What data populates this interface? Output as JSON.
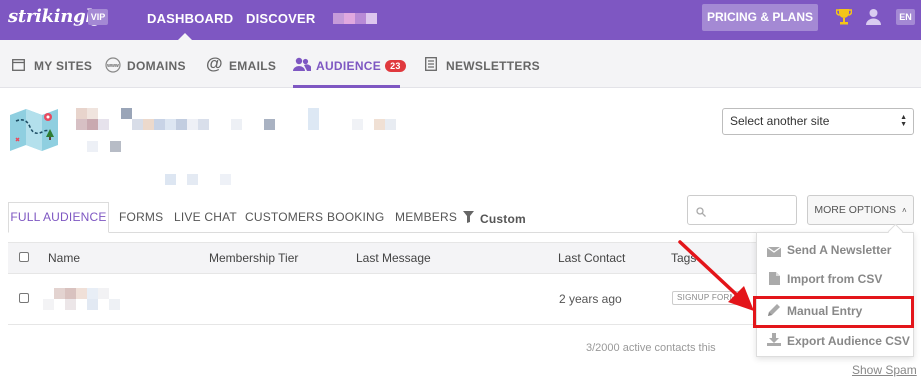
{
  "topbar": {
    "logo": "strikingly",
    "vip": "VIP",
    "nav": [
      "DASHBOARD",
      "DISCOVER"
    ],
    "pricing_label": "PRICING & PLANS",
    "lang": "EN",
    "icons": [
      "trophy-icon",
      "user-icon"
    ],
    "colors": {
      "bar": "#7e57c2",
      "button": "#a489d4"
    }
  },
  "subnav": {
    "tabs": [
      {
        "label": "MY SITES",
        "icon": "window-icon"
      },
      {
        "label": "DOMAINS",
        "icon": "www-icon"
      },
      {
        "label": "EMAILS",
        "icon": "at-icon"
      },
      {
        "label": "AUDIENCE",
        "icon": "users-icon",
        "badge": "23",
        "active": true
      },
      {
        "label": "NEWSLETTERS",
        "icon": "newsletter-icon"
      }
    ],
    "colors": {
      "active": "#7e57c2",
      "badge": "#e0393e"
    }
  },
  "site": {
    "select_placeholder": "Select another site",
    "illustration": "map-icon"
  },
  "audience": {
    "tabs": [
      "FULL AUDIENCE",
      "FORMS",
      "LIVE CHAT",
      "CUSTOMERS",
      "BOOKING",
      "MEMBERS",
      "Custom"
    ],
    "more_options": "MORE OPTIONS",
    "columns": [
      "Name",
      "Membership Tier",
      "Last Message",
      "Last Contact",
      "Tags"
    ],
    "rows": [
      {
        "last_contact": "2 years ago",
        "tag": "SIGNUP FORM"
      }
    ],
    "count_text": "3/2000 active contacts this",
    "show_spam": "Show Spam"
  },
  "dropdown": {
    "items": [
      {
        "label": "Send A Newsletter",
        "icon": "envelope-icon"
      },
      {
        "label": "Import from CSV",
        "icon": "file-icon"
      },
      {
        "label": "Manual Entry",
        "icon": "pencil-icon",
        "highlighted": true
      },
      {
        "label": "Export Audience CSV",
        "icon": "download-icon"
      }
    ],
    "highlight_color": "#e3151a"
  }
}
